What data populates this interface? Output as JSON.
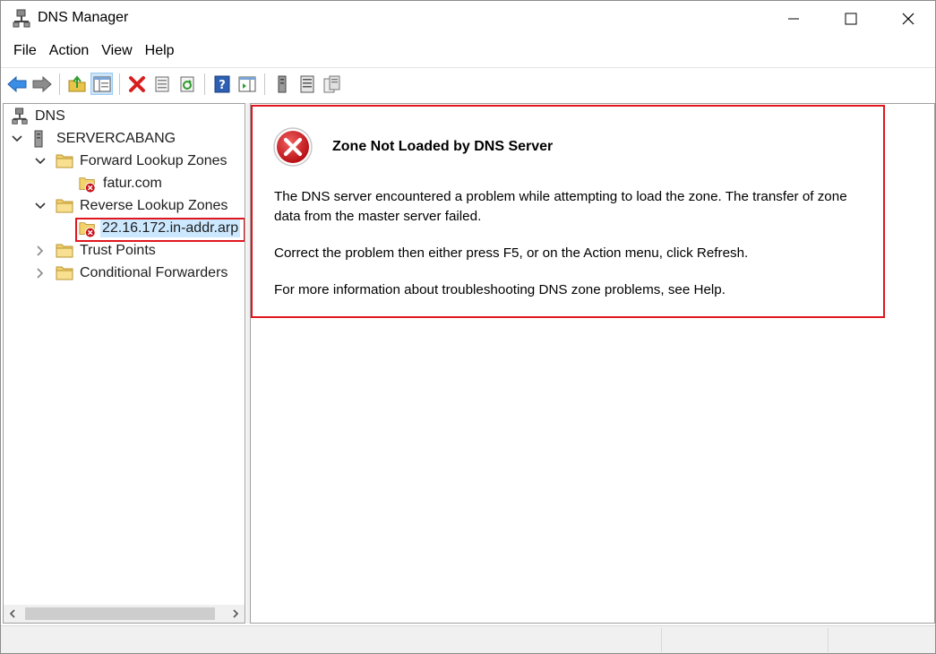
{
  "window": {
    "title": "DNS Manager"
  },
  "menu": {
    "items": [
      "File",
      "Action",
      "View",
      "Help"
    ]
  },
  "toolbar": {
    "icons": [
      "back-icon",
      "forward-icon",
      "up-folder-icon",
      "show-hide-tree-icon",
      "delete-icon",
      "properties-icon",
      "refresh-icon",
      "help-icon",
      "show-action-pane-icon",
      "server-icon",
      "list-icon",
      "records-icon"
    ]
  },
  "tree": {
    "root": "DNS",
    "server": "SERVERCABANG",
    "forward_zones": "Forward Lookup Zones",
    "forward_zone_item": "fatur.com",
    "reverse_zones": "Reverse Lookup Zones",
    "reverse_zone_item": "22.16.172.in-addr.arp",
    "trust_points": "Trust Points",
    "conditional_forwarders": "Conditional Forwarders"
  },
  "message": {
    "title": "Zone Not Loaded by DNS Server",
    "line1": "The DNS server encountered a problem while attempting to load the zone. The transfer of zone data from the master server failed.",
    "line2": "Correct the problem then either press F5, or on the Action menu, click Refresh.",
    "line3": "For more information about troubleshooting DNS zone problems, see Help."
  },
  "colors": {
    "highlight": "#e0161e",
    "selection": "#cce8ff",
    "error": "#c8151b"
  }
}
